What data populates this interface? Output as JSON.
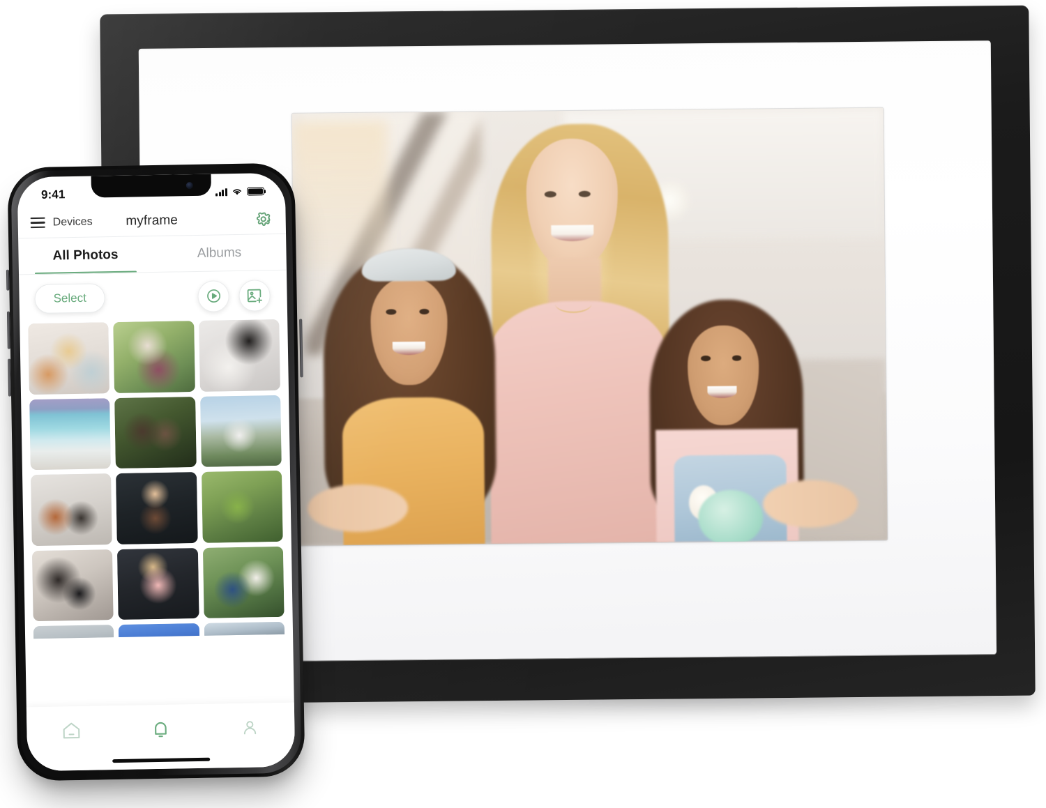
{
  "scene": {
    "description": "Digital photo frame displaying a family photo, with a smartphone in front showing the companion photo app"
  },
  "frame_device": {
    "name": "digital-photo-frame",
    "bezel_color": "#161616",
    "mat_color": "#ffffff",
    "displayed_photo": "family-portrait-mother-and-two-girls"
  },
  "phone": {
    "status_bar": {
      "time": "9:41",
      "signal_icon": "cellular-signal-icon",
      "wifi_icon": "wifi-icon",
      "battery_icon": "battery-full-icon"
    },
    "nav_bar": {
      "menu_icon": "hamburger-menu-icon",
      "back_label": "Devices",
      "title": "myframe",
      "settings_icon": "gear-icon"
    },
    "tabs": [
      {
        "label": "All Photos",
        "active": true
      },
      {
        "label": "Albums",
        "active": false
      }
    ],
    "toolbar": {
      "select_label": "Select",
      "slideshow_icon": "play-circle-icon",
      "add_photo_icon": "add-image-icon"
    },
    "photo_grid": {
      "rows": [
        [
          {
            "id": "t1",
            "alt": "mother and two girls on couch"
          },
          {
            "id": "t2",
            "alt": "two children hugging in striped scarf outdoors"
          },
          {
            "id": "t3",
            "alt": "parent holding newborn baby in blanket"
          }
        ],
        [
          {
            "id": "t4",
            "alt": "mother and daughter hugging at the beach"
          },
          {
            "id": "t5",
            "alt": "two young brothers hugging outdoors"
          },
          {
            "id": "t6",
            "alt": "large family group portrait outdoors"
          }
        ],
        [
          {
            "id": "t7",
            "alt": "three women smiling on a city street"
          },
          {
            "id": "t8",
            "alt": "father with toddler on his shoulders"
          },
          {
            "id": "t9",
            "alt": "girl in green jacket blowing bubbles"
          }
        ],
        [
          {
            "id": "t10",
            "alt": "woman holding ultrasound photo"
          },
          {
            "id": "t11",
            "alt": "two sisters hugging with buns in hair"
          },
          {
            "id": "t12",
            "alt": "grandfather holding toddler girl outdoors"
          }
        ],
        [
          {
            "id": "t13",
            "alt": "partially visible photo"
          },
          {
            "id": "t14",
            "alt": "partially visible blue photo"
          },
          {
            "id": "t15",
            "alt": "partially visible sky photo"
          }
        ]
      ]
    },
    "tab_bar": [
      {
        "icon": "home-icon",
        "name": "home",
        "active": false
      },
      {
        "icon": "bell-icon",
        "name": "notifications",
        "active": true
      },
      {
        "icon": "person-icon",
        "name": "profile",
        "active": false
      }
    ]
  },
  "colors": {
    "accent_green": "#69ab7d",
    "inactive_green": "#bdd4c6",
    "text_dark": "#1d1d1d",
    "text_muted": "#9b9ea1",
    "background": "#ffffff"
  }
}
